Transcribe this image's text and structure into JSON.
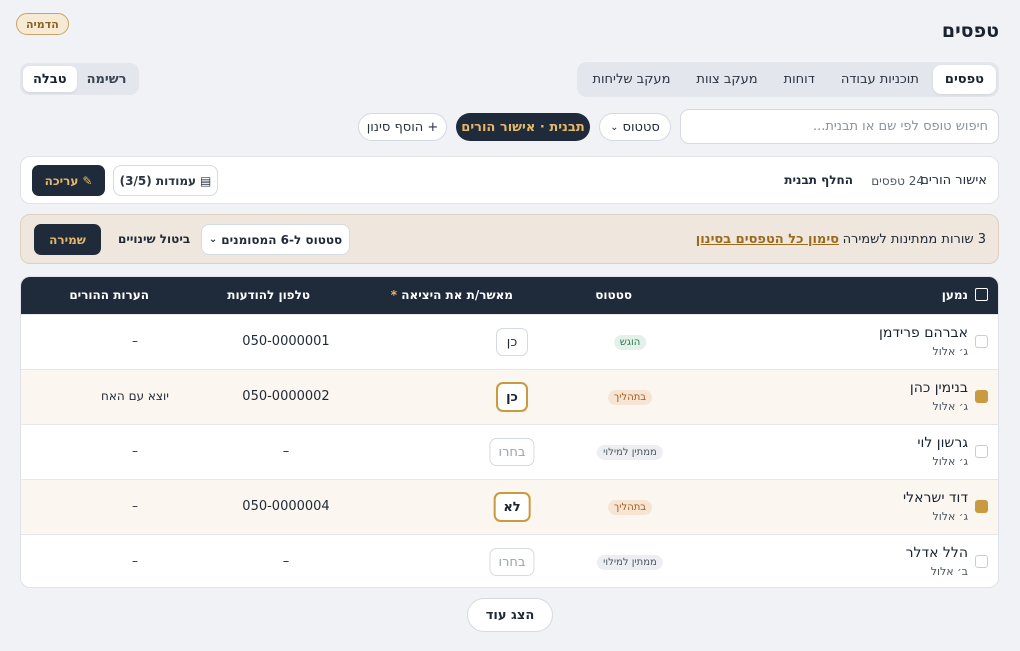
{
  "demo_badge": "הדמיה",
  "page_title": "טפסים",
  "tabs": [
    {
      "label": "טפסים",
      "active": true
    },
    {
      "label": "תוכניות עבודה",
      "active": false
    },
    {
      "label": "דוחות",
      "active": false
    },
    {
      "label": "מעקב צוות",
      "active": false
    },
    {
      "label": "מעקב שליחות",
      "active": false
    }
  ],
  "view_toggle": {
    "list": "רשימה",
    "table": "טבלה",
    "active": "table"
  },
  "filters": {
    "search_placeholder": "חיפוש טופס לפי שם או תבנית...",
    "status_label": "סטטוס",
    "template_label": "תבנית · אישור הורים",
    "add_filter_label": "+ הוסף סינון"
  },
  "template_card": {
    "name": "אישור הורים",
    "count": "24 טפסים",
    "switch_label": "החלף תבנית",
    "columns_label": "עמודות (3/5)",
    "edit_label": "עריכה"
  },
  "pending": {
    "text": "3 שורות ממתינות לשמירה",
    "select_all_link": "סימון כל הטפסים בסינון",
    "bulk_status_label": "סטטוס ל-6 המסומנים",
    "cancel_label": "ביטול שינויים",
    "save_label": "שמירה"
  },
  "table": {
    "headers": {
      "name": "נמען",
      "status": "סטטוס",
      "approver": "מאשר/ת את היציאה",
      "approver_required": "*",
      "phone": "טלפון להודעות",
      "notes": "הערות ההורים"
    },
    "rows": [
      {
        "name": "אברהם פרידמן",
        "class": "ג׳ אלול",
        "checked": false,
        "status": "הוגש",
        "status_kind": "sent",
        "approver": "כן",
        "approver_kind": "plain",
        "phone": "050-0000001",
        "notes": "–"
      },
      {
        "name": "בנימין כהן",
        "class": "ג׳ אלול",
        "checked": true,
        "status": "בתהליך",
        "status_kind": "progress",
        "approver": "כן",
        "approver_kind": "sel",
        "phone": "050-0000002",
        "notes": "יוצא עם האח"
      },
      {
        "name": "גרשון לוי",
        "class": "ג׳ אלול",
        "checked": false,
        "status": "ממתין למילוי",
        "status_kind": "wait",
        "approver": "בחרו",
        "approver_kind": "empty",
        "phone": "–",
        "notes": "–"
      },
      {
        "name": "דוד ישראלי",
        "class": "ג׳ אלול",
        "checked": true,
        "status": "בתהליך",
        "status_kind": "progress",
        "approver": "לא",
        "approver_kind": "sel",
        "phone": "050-0000004",
        "notes": "–"
      },
      {
        "name": "הלל אדלר",
        "class": "ב׳ אלול",
        "checked": false,
        "status": "ממתין למילוי",
        "status_kind": "wait",
        "approver": "בחרו",
        "approver_kind": "empty",
        "phone": "–",
        "notes": "–"
      }
    ]
  },
  "show_more_label": "הצג עוד"
}
